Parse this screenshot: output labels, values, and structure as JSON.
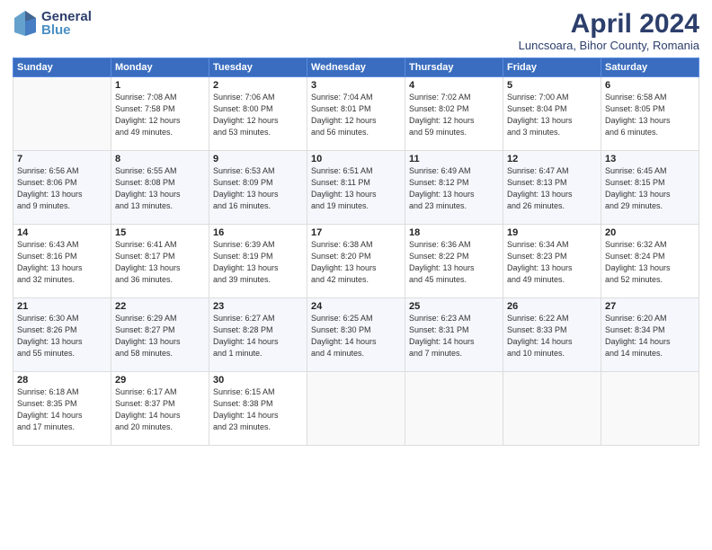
{
  "header": {
    "logo_general": "General",
    "logo_blue": "Blue",
    "month_title": "April 2024",
    "location": "Luncsoara, Bihor County, Romania"
  },
  "weekdays": [
    "Sunday",
    "Monday",
    "Tuesday",
    "Wednesday",
    "Thursday",
    "Friday",
    "Saturday"
  ],
  "weeks": [
    [
      {
        "day": "",
        "info": ""
      },
      {
        "day": "1",
        "info": "Sunrise: 7:08 AM\nSunset: 7:58 PM\nDaylight: 12 hours\nand 49 minutes."
      },
      {
        "day": "2",
        "info": "Sunrise: 7:06 AM\nSunset: 8:00 PM\nDaylight: 12 hours\nand 53 minutes."
      },
      {
        "day": "3",
        "info": "Sunrise: 7:04 AM\nSunset: 8:01 PM\nDaylight: 12 hours\nand 56 minutes."
      },
      {
        "day": "4",
        "info": "Sunrise: 7:02 AM\nSunset: 8:02 PM\nDaylight: 12 hours\nand 59 minutes."
      },
      {
        "day": "5",
        "info": "Sunrise: 7:00 AM\nSunset: 8:04 PM\nDaylight: 13 hours\nand 3 minutes."
      },
      {
        "day": "6",
        "info": "Sunrise: 6:58 AM\nSunset: 8:05 PM\nDaylight: 13 hours\nand 6 minutes."
      }
    ],
    [
      {
        "day": "7",
        "info": "Sunrise: 6:56 AM\nSunset: 8:06 PM\nDaylight: 13 hours\nand 9 minutes."
      },
      {
        "day": "8",
        "info": "Sunrise: 6:55 AM\nSunset: 8:08 PM\nDaylight: 13 hours\nand 13 minutes."
      },
      {
        "day": "9",
        "info": "Sunrise: 6:53 AM\nSunset: 8:09 PM\nDaylight: 13 hours\nand 16 minutes."
      },
      {
        "day": "10",
        "info": "Sunrise: 6:51 AM\nSunset: 8:11 PM\nDaylight: 13 hours\nand 19 minutes."
      },
      {
        "day": "11",
        "info": "Sunrise: 6:49 AM\nSunset: 8:12 PM\nDaylight: 13 hours\nand 23 minutes."
      },
      {
        "day": "12",
        "info": "Sunrise: 6:47 AM\nSunset: 8:13 PM\nDaylight: 13 hours\nand 26 minutes."
      },
      {
        "day": "13",
        "info": "Sunrise: 6:45 AM\nSunset: 8:15 PM\nDaylight: 13 hours\nand 29 minutes."
      }
    ],
    [
      {
        "day": "14",
        "info": "Sunrise: 6:43 AM\nSunset: 8:16 PM\nDaylight: 13 hours\nand 32 minutes."
      },
      {
        "day": "15",
        "info": "Sunrise: 6:41 AM\nSunset: 8:17 PM\nDaylight: 13 hours\nand 36 minutes."
      },
      {
        "day": "16",
        "info": "Sunrise: 6:39 AM\nSunset: 8:19 PM\nDaylight: 13 hours\nand 39 minutes."
      },
      {
        "day": "17",
        "info": "Sunrise: 6:38 AM\nSunset: 8:20 PM\nDaylight: 13 hours\nand 42 minutes."
      },
      {
        "day": "18",
        "info": "Sunrise: 6:36 AM\nSunset: 8:22 PM\nDaylight: 13 hours\nand 45 minutes."
      },
      {
        "day": "19",
        "info": "Sunrise: 6:34 AM\nSunset: 8:23 PM\nDaylight: 13 hours\nand 49 minutes."
      },
      {
        "day": "20",
        "info": "Sunrise: 6:32 AM\nSunset: 8:24 PM\nDaylight: 13 hours\nand 52 minutes."
      }
    ],
    [
      {
        "day": "21",
        "info": "Sunrise: 6:30 AM\nSunset: 8:26 PM\nDaylight: 13 hours\nand 55 minutes."
      },
      {
        "day": "22",
        "info": "Sunrise: 6:29 AM\nSunset: 8:27 PM\nDaylight: 13 hours\nand 58 minutes."
      },
      {
        "day": "23",
        "info": "Sunrise: 6:27 AM\nSunset: 8:28 PM\nDaylight: 14 hours\nand 1 minute."
      },
      {
        "day": "24",
        "info": "Sunrise: 6:25 AM\nSunset: 8:30 PM\nDaylight: 14 hours\nand 4 minutes."
      },
      {
        "day": "25",
        "info": "Sunrise: 6:23 AM\nSunset: 8:31 PM\nDaylight: 14 hours\nand 7 minutes."
      },
      {
        "day": "26",
        "info": "Sunrise: 6:22 AM\nSunset: 8:33 PM\nDaylight: 14 hours\nand 10 minutes."
      },
      {
        "day": "27",
        "info": "Sunrise: 6:20 AM\nSunset: 8:34 PM\nDaylight: 14 hours\nand 14 minutes."
      }
    ],
    [
      {
        "day": "28",
        "info": "Sunrise: 6:18 AM\nSunset: 8:35 PM\nDaylight: 14 hours\nand 17 minutes."
      },
      {
        "day": "29",
        "info": "Sunrise: 6:17 AM\nSunset: 8:37 PM\nDaylight: 14 hours\nand 20 minutes."
      },
      {
        "day": "30",
        "info": "Sunrise: 6:15 AM\nSunset: 8:38 PM\nDaylight: 14 hours\nand 23 minutes."
      },
      {
        "day": "",
        "info": ""
      },
      {
        "day": "",
        "info": ""
      },
      {
        "day": "",
        "info": ""
      },
      {
        "day": "",
        "info": ""
      }
    ]
  ]
}
